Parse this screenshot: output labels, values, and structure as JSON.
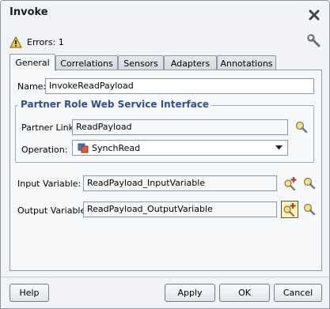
{
  "window": {
    "title": "Invoke"
  },
  "errors": {
    "text": "Errors: 1"
  },
  "tabs": [
    {
      "label": "General",
      "active": true
    },
    {
      "label": "Correlations",
      "active": false
    },
    {
      "label": "Sensors",
      "active": false
    },
    {
      "label": "Adapters",
      "active": false
    },
    {
      "label": "Annotations",
      "active": false
    }
  ],
  "general": {
    "name_label": "Name:",
    "name_value": "InvokeReadPayload",
    "group_title": "Partner Role Web Service Interface",
    "partner_link_label": "Partner Link:",
    "partner_link_value": "ReadPayload",
    "operation_label": "Operation:",
    "operation_value": "SynchRead",
    "input_variable_label": "Input Variable:",
    "input_variable_value": "ReadPayload_InputVariable",
    "output_variable_label": "Output Variable:",
    "output_variable_value": "ReadPayload_OutputVariable"
  },
  "buttons": {
    "help": "Help",
    "apply": "Apply",
    "ok": "OK",
    "cancel": "Cancel"
  },
  "icons": {
    "close": "close-icon",
    "warning": "warning-icon",
    "wrench": "wrench-icon",
    "flashlight": "flashlight-icon",
    "add_variable": "add-variable-icon",
    "operation": "operation-icon",
    "dropdown": "chevron-down-icon"
  },
  "colors": {
    "group_title": "#2d4f94",
    "background": "#f1f3f7"
  }
}
